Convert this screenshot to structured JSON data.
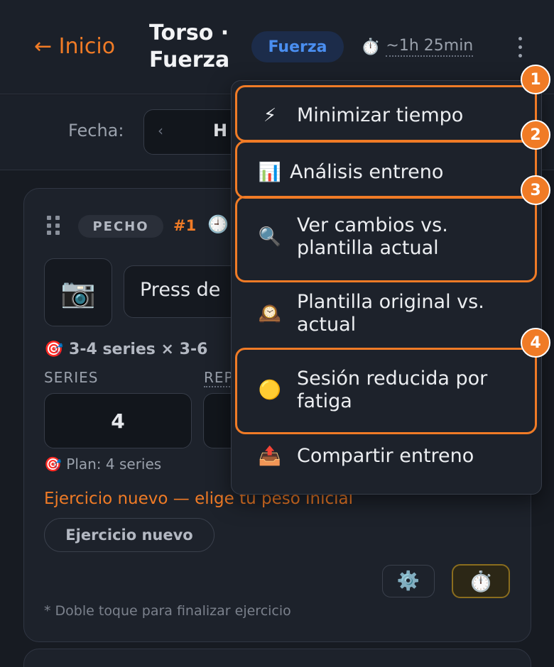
{
  "header": {
    "back_label": "← Inicio",
    "title": "Torso · Fuerza",
    "type_badge": "Fuerza",
    "duration_icon": "stopwatch-icon",
    "duration": "~1h 25min",
    "menu_icon": "kebab-icon"
  },
  "datebar": {
    "label": "Fecha:",
    "prev_icon": "chevron-left-icon",
    "value": "H"
  },
  "exercise": {
    "muscle": "PECHO",
    "order": "#1",
    "clock_icon": "🕘",
    "photo_icon": "📷",
    "name": "Press de",
    "target": "🎯 3-4 series × 3-6",
    "series_label": "SERIES",
    "reps_label": "REPS",
    "series_value": "4",
    "plan": "🎯 Plan: 4 series",
    "new_message": "Ejercicio nuevo — elige tu peso inicial",
    "new_chip": "Ejercicio nuevo",
    "settings_icon": "⚙️",
    "timer_icon": "⏱️",
    "footnote": "* Doble toque para finalizar ejercicio"
  },
  "menu": {
    "items": [
      {
        "icon": "⚡",
        "label": "Minimizar tiempo"
      },
      {
        "icon": "📊",
        "label": "Análisis entreno"
      },
      {
        "icon": "🔍",
        "label": "Ver cambios vs. plantilla actual"
      },
      {
        "icon": "🕰️",
        "label": "Plantilla original vs. actual"
      },
      {
        "icon": "🟡",
        "label": "Sesión reducida por fatiga"
      },
      {
        "icon": "📤",
        "label": "Compartir entreno"
      }
    ],
    "markers": [
      "1",
      "2",
      "3",
      "4"
    ]
  },
  "colors": {
    "accent": "#f07b26",
    "badge_blue": "#4a8ef0",
    "background": "#171b22",
    "card": "#1d222b"
  }
}
